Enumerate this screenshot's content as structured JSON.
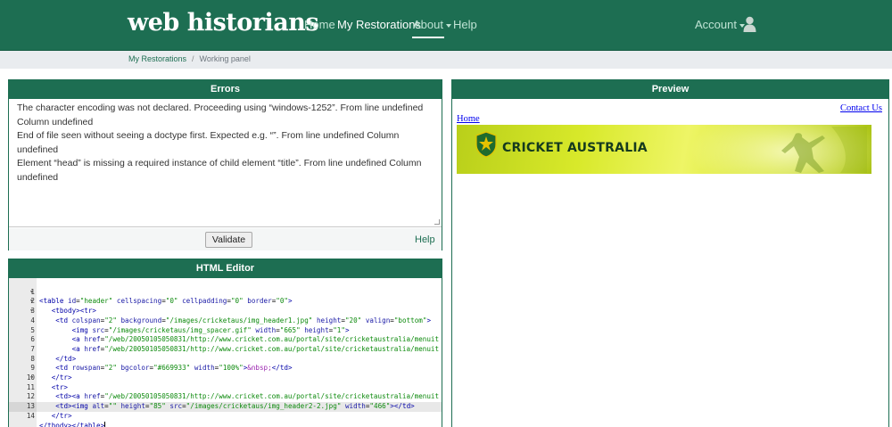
{
  "brand": {
    "name": "web historians"
  },
  "nav": {
    "home": "Home",
    "my_restorations": "My Restorations",
    "about": "About",
    "help": "Help",
    "account": "Account"
  },
  "breadcrumb": {
    "parent": "My Restorations",
    "separator": "/",
    "current": "Working panel"
  },
  "errors_panel": {
    "title": "Errors",
    "lines": [
      "The character encoding was not declared. Proceeding using “windows-1252”. From line undefined Column undefined",
      "End of file seen without seeing a doctype first. Expected e.g. “”. From line undefined Column undefined",
      "Element “head” is missing a required instance of child element “title”. From line undefined Column undefined"
    ],
    "validate_label": "Validate",
    "help_label": "Help"
  },
  "editor_panel": {
    "title": "HTML Editor",
    "active_line": 14
  },
  "preview_panel": {
    "title": "Preview",
    "home_link": "Home",
    "contact_link": "Contact Us",
    "banner_text": "CRICKET AUSTRALIA"
  },
  "colors": {
    "brand_green": "#1d6e52",
    "breadcrumb_bg": "#e9ecef",
    "banner_yellow": "#d8e92a"
  },
  "icons": {
    "user": "user-icon",
    "caret": "caret-down-icon",
    "fold": "fold-arrow-icon"
  }
}
